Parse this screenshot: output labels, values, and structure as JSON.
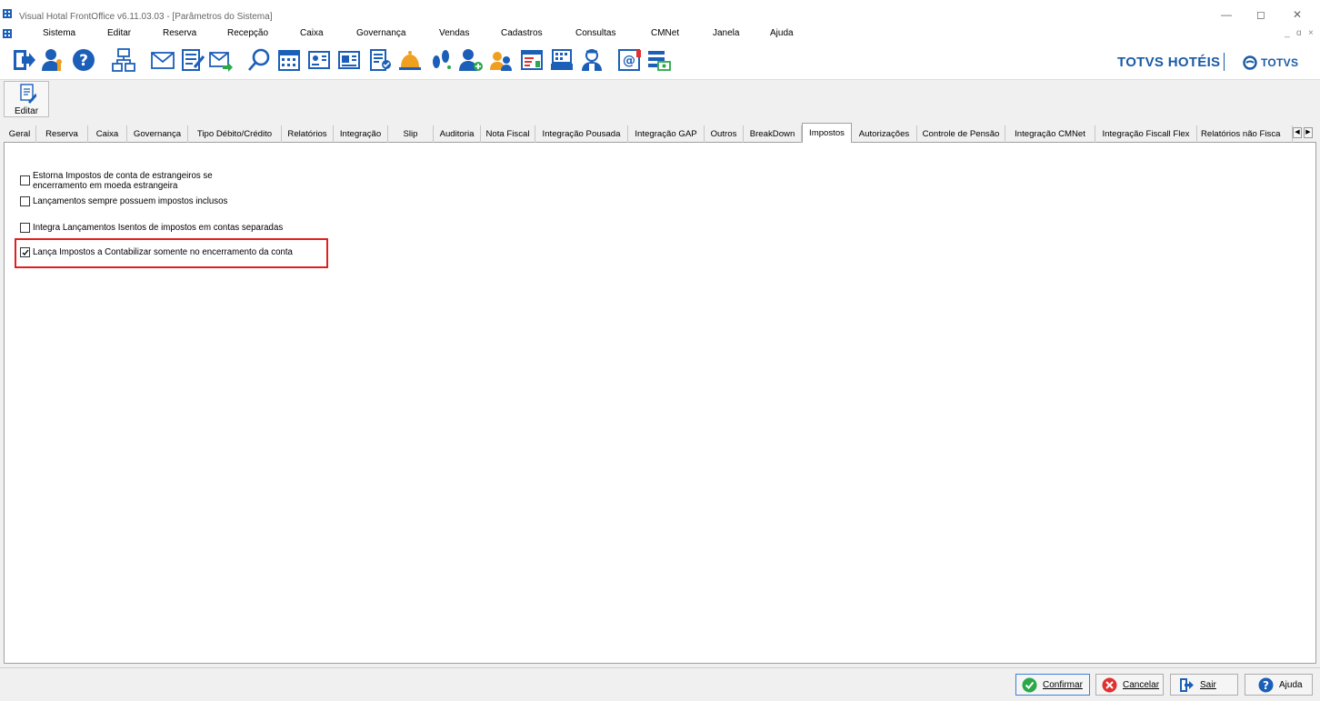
{
  "window": {
    "title": "Visual Hotal FrontOffice v6.11.03.03 - [Parâmetros do Sistema]",
    "controls": [
      "—",
      "◻",
      "✕"
    ],
    "mdi_controls": [
      "_",
      "ɑ",
      "×"
    ]
  },
  "menu": [
    "Sistema",
    "Editar",
    "Reserva",
    "Recepção",
    "Caixa",
    "Governança",
    "Vendas",
    "Cadastros",
    "Consultas",
    "CMNet",
    "Janela",
    "Ajuda"
  ],
  "brand": {
    "primary": "TOTVS HOTÉIS",
    "secondary": "TOTVS",
    "color": "#1a5aa6"
  },
  "toolbar_icons": [
    "exit-icon",
    "user-key-icon",
    "help-icon",
    "sitemap-icon",
    "mail-icon",
    "checklist-icon",
    "mail-forward-icon",
    "search-icon",
    "calendar-icon",
    "card-icon",
    "card-alt-icon",
    "report-user-icon",
    "bell-icon",
    "footprints-icon",
    "user-add-icon",
    "users-icon",
    "table-report-icon",
    "register-icon",
    "maid-icon",
    "email-icon",
    "list-money-icon"
  ],
  "edit_button": {
    "label": "Editar"
  },
  "tabs": [
    {
      "label": "Geral"
    },
    {
      "label": "Reserva"
    },
    {
      "label": "Caixa"
    },
    {
      "label": "Governança"
    },
    {
      "label": "Tipo Débito/Crédito"
    },
    {
      "label": "Relatórios"
    },
    {
      "label": "Integração"
    },
    {
      "label": "Slip"
    },
    {
      "label": "Auditoria"
    },
    {
      "label": "Nota Fiscal"
    },
    {
      "label": "Integração Pousada"
    },
    {
      "label": "Integração GAP"
    },
    {
      "label": "Outros"
    },
    {
      "label": "BreakDown"
    },
    {
      "label": "Impostos"
    },
    {
      "label": "Autorizações"
    },
    {
      "label": "Controle de Pensão"
    },
    {
      "label": "Integração CMNet"
    },
    {
      "label": "Integração Fiscall Flex"
    },
    {
      "label": "Relatórios não Fisca"
    }
  ],
  "active_tab": "Impostos",
  "options": [
    {
      "line1": "Estorna Impostos de conta de estrangeiros se",
      "line2": "encerramento em moeda estrangeira",
      "checked": false
    },
    {
      "line1": "Lançamentos sempre possuem impostos inclusos",
      "checked": false
    },
    {
      "line1": "Integra Lançamentos Isentos de impostos em contas separadas",
      "checked": false
    },
    {
      "line1": "Lança Impostos a Contabilizar somente no encerramento da conta",
      "checked": true
    }
  ],
  "footer_buttons": {
    "confirm": "Confirmar",
    "cancel": "Cancelar",
    "exit": "Sair",
    "help": "Ajuda"
  }
}
